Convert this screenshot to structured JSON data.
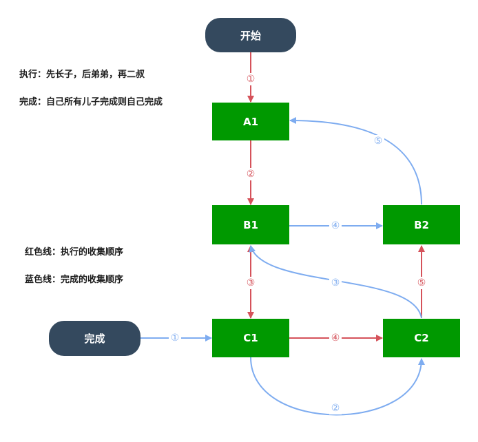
{
  "colors": {
    "red": "#d5525a",
    "blue": "#7eacf0",
    "green": "#009900",
    "dark": "#34495e"
  },
  "notes": {
    "exec": "执行：先长子，后弟弟，再二叔",
    "done": "完成：自己所有儿子完成则自己完成",
    "red_line": "红色线：执行的收集顺序",
    "blue_line": "蓝色线：完成的收集顺序"
  },
  "nodes": {
    "start": "开始",
    "finish": "完成",
    "a1": "A1",
    "b1": "B1",
    "b2": "B2",
    "c1": "C1",
    "c2": "C2"
  },
  "edges": {
    "start_a1": "①",
    "a1_b1": "②",
    "b1_c1": "③",
    "c1_c2": "④",
    "c2_b2": "⑤",
    "finish_c1": "①",
    "c1_c2_curve": "②",
    "c2_b1": "③",
    "b1_b2": "④",
    "b2_a1": "⑤"
  }
}
